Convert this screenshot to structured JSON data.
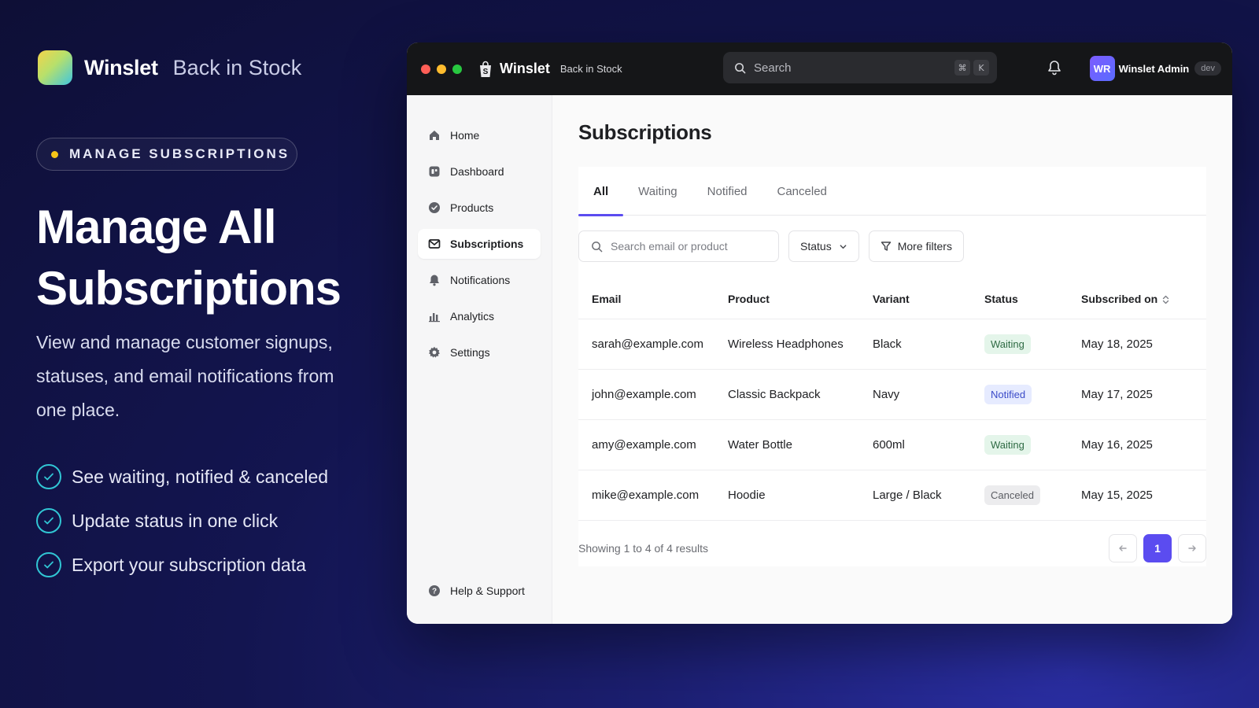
{
  "brand": {
    "name": "Winslet",
    "product": "Back in Stock"
  },
  "pill": {
    "label": "MANAGE SUBSCRIPTIONS",
    "dot_color": "#f5c518"
  },
  "hero": {
    "headline_line1": "Manage All",
    "headline_line2": "Subscriptions",
    "lead": "View and manage customer signups, statuses, and email notifications from one place.",
    "features": [
      "See waiting, notified & canceled",
      "Update status in one click",
      "Export your subscription data"
    ]
  },
  "titlebar": {
    "app_name": "Winslet",
    "app_sub": "Back in Stock",
    "search_label": "Search",
    "shortcut_keys": [
      "⌘",
      "K"
    ],
    "user_initials": "WR",
    "user_name": "Winslet Admin",
    "env_badge": "dev"
  },
  "sidebar": {
    "items": [
      {
        "label": "Home",
        "icon": "home-icon"
      },
      {
        "label": "Dashboard",
        "icon": "dashboard-icon"
      },
      {
        "label": "Products",
        "icon": "tag-icon"
      },
      {
        "label": "Subscriptions",
        "icon": "mail-icon",
        "active": true
      },
      {
        "label": "Notifications",
        "icon": "bell-icon"
      },
      {
        "label": "Analytics",
        "icon": "bar-chart-icon"
      },
      {
        "label": "Settings",
        "icon": "gear-icon"
      }
    ],
    "help_label": "Help & Support"
  },
  "main": {
    "title": "Subscriptions",
    "tabs": [
      {
        "label": "All",
        "active": true
      },
      {
        "label": "Waiting"
      },
      {
        "label": "Notified"
      },
      {
        "label": "Canceled"
      }
    ],
    "search_placeholder": "Search email or product",
    "status_filter_label": "Status",
    "more_filters_label": "More filters",
    "table": {
      "columns": [
        "Email",
        "Product",
        "Variant",
        "Status",
        "Subscribed on"
      ],
      "rows": [
        {
          "email": "sarah@example.com",
          "product": "Wireless Headphones",
          "variant": "Black",
          "status": "Waiting",
          "date": "May 18, 2025"
        },
        {
          "email": "john@example.com",
          "product": "Classic Backpack",
          "variant": "Navy",
          "status": "Notified",
          "date": "May 17, 2025"
        },
        {
          "email": "amy@example.com",
          "product": "Water Bottle",
          "variant": "600ml",
          "status": "Waiting",
          "date": "May 16, 2025"
        },
        {
          "email": "mike@example.com",
          "product": "Hoodie",
          "variant": "Large / Black",
          "status": "Canceled",
          "date": "May 15, 2025"
        }
      ]
    },
    "results_text": "Showing 1 to 4 of 4 results",
    "current_page": "1"
  },
  "colors": {
    "accent": "#5b4cf0",
    "waiting": "#e4f5ea",
    "notified": "#e6ebff",
    "canceled": "#ececee",
    "check": "#31c6d4"
  }
}
